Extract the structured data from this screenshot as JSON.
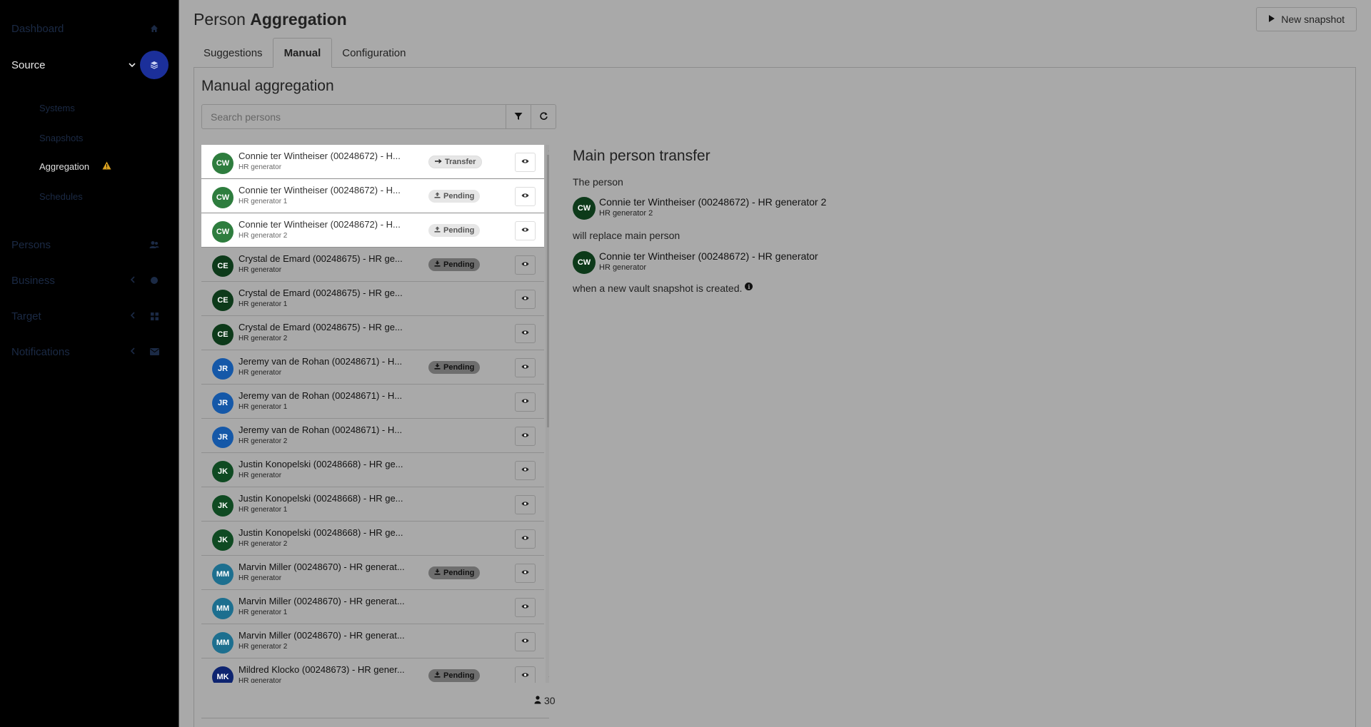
{
  "sidebar": {
    "items": [
      {
        "label": "Dashboard",
        "icon": "home-icon"
      },
      {
        "label": "Source",
        "icon": "layers-icon"
      },
      {
        "label": "Persons",
        "icon": "users-icon"
      },
      {
        "label": "Business",
        "icon": "globe-icon"
      },
      {
        "label": "Target",
        "icon": "grid-icon"
      },
      {
        "label": "Notifications",
        "icon": "envelope-icon"
      }
    ],
    "source_sub": [
      {
        "label": "Systems"
      },
      {
        "label": "Snapshots"
      },
      {
        "label": "Aggregation",
        "warning": true
      },
      {
        "label": "Schedules"
      }
    ]
  },
  "header": {
    "title_light": "Person",
    "title_bold": "Aggregation",
    "new_snapshot_label": "New snapshot"
  },
  "tabs": [
    {
      "label": "Suggestions"
    },
    {
      "label": "Manual",
      "active": true
    },
    {
      "label": "Configuration"
    }
  ],
  "manual": {
    "title": "Manual aggregation",
    "search_placeholder": "Search persons",
    "count": "30"
  },
  "persons": [
    {
      "initials": "CW",
      "name": "Connie ter Wintheiser (00248672) - H...",
      "system": "HR generator",
      "badge": "Transfer",
      "color": "#2e7d3e",
      "highlight": true
    },
    {
      "initials": "CW",
      "name": "Connie ter Wintheiser (00248672) - H...",
      "system": "HR generator 1",
      "badge": "Pending",
      "color": "#2e7d3e",
      "highlight": true
    },
    {
      "initials": "CW",
      "name": "Connie ter Wintheiser (00248672) - H...",
      "system": "HR generator 2",
      "badge": "Pending",
      "color": "#2e7d3e",
      "highlight": true
    },
    {
      "initials": "CE",
      "name": "Crystal de Emard (00248675) - HR ge...",
      "system": "HR generator",
      "badge": "Pending",
      "color": "#0d3a1a"
    },
    {
      "initials": "CE",
      "name": "Crystal de Emard (00248675) - HR ge...",
      "system": "HR generator 1",
      "badge": "",
      "color": "#0d3a1a"
    },
    {
      "initials": "CE",
      "name": "Crystal de Emard (00248675) - HR ge...",
      "system": "HR generator 2",
      "badge": "",
      "color": "#0d3a1a"
    },
    {
      "initials": "JR",
      "name": "Jeremy van de Rohan (00248671) - H...",
      "system": "HR generator",
      "badge": "Pending",
      "color": "#1558a8"
    },
    {
      "initials": "JR",
      "name": "Jeremy van de Rohan (00248671) - H...",
      "system": "HR generator 1",
      "badge": "",
      "color": "#1558a8"
    },
    {
      "initials": "JR",
      "name": "Jeremy van de Rohan (00248671) - H...",
      "system": "HR generator 2",
      "badge": "",
      "color": "#1558a8"
    },
    {
      "initials": "JK",
      "name": "Justin Konopelski (00248668) - HR ge...",
      "system": "HR generator",
      "badge": "",
      "color": "#0f4a22"
    },
    {
      "initials": "JK",
      "name": "Justin Konopelski (00248668) - HR ge...",
      "system": "HR generator 1",
      "badge": "",
      "color": "#0f4a22"
    },
    {
      "initials": "JK",
      "name": "Justin Konopelski (00248668) - HR ge...",
      "system": "HR generator 2",
      "badge": "",
      "color": "#0f4a22"
    },
    {
      "initials": "MM",
      "name": "Marvin Miller (00248670) - HR generat...",
      "system": "HR generator",
      "badge": "Pending",
      "color": "#1d6f8f"
    },
    {
      "initials": "MM",
      "name": "Marvin Miller (00248670) - HR generat...",
      "system": "HR generator 1",
      "badge": "",
      "color": "#1d6f8f"
    },
    {
      "initials": "MM",
      "name": "Marvin Miller (00248670) - HR generat...",
      "system": "HR generator 2",
      "badge": "",
      "color": "#1d6f8f"
    },
    {
      "initials": "MK",
      "name": "Mildred Klocko (00248673) - HR gener...",
      "system": "HR generator",
      "badge": "Pending",
      "color": "#0e2470"
    }
  ],
  "detail": {
    "title": "Main person transfer",
    "the_person": "The person",
    "from_name": "Connie ter Wintheiser (00248672) - HR generator 2",
    "from_system": "HR generator 2",
    "from_initials": "CW",
    "will_replace": "will replace main person",
    "to_name": "Connie ter Wintheiser (00248672) - HR generator",
    "to_system": "HR generator",
    "to_initials": "CW",
    "when_text": "when a new vault snapshot is created."
  }
}
